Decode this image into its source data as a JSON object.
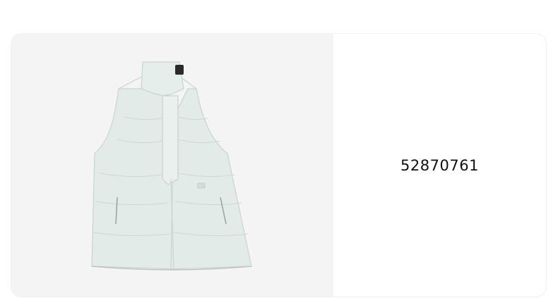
{
  "product": {
    "id": "52870761",
    "image_subject": "vest-illustration",
    "colors": {
      "vest": "#e3ebe9",
      "vest_shade": "#c9d3d1",
      "image_bg": "#f4f4f4",
      "label": "#2a2a2a"
    }
  }
}
